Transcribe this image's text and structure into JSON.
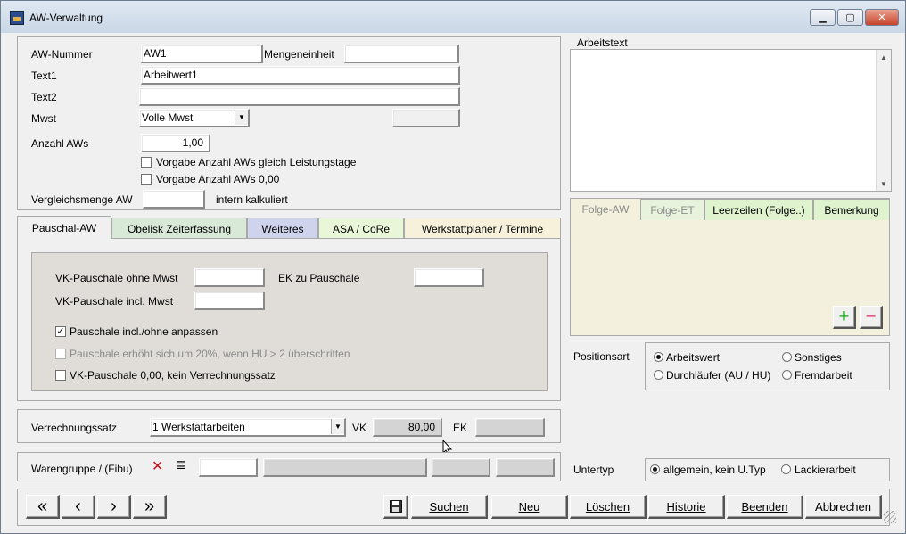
{
  "window": {
    "title": "AW-Verwaltung"
  },
  "fields": {
    "aw_nummer": {
      "label": "AW-Nummer",
      "value": "AW1"
    },
    "mengeneinheit": {
      "label": "Mengeneinheit",
      "value": ""
    },
    "text1": {
      "label": "Text1",
      "value": "Arbeitwert1"
    },
    "text2": {
      "label": "Text2",
      "value": ""
    },
    "mwst": {
      "label": "Mwst",
      "value": "Volle Mwst"
    },
    "anzahl_aws": {
      "label": "Anzahl AWs",
      "value": "1,00"
    },
    "vorgabe_leistungstage": {
      "label": "Vorgabe Anzahl AWs gleich Leistungstage",
      "checked": false
    },
    "vorgabe_null": {
      "label": "Vorgabe Anzahl AWs 0,00",
      "checked": false
    },
    "vergleichsmenge": {
      "label": "Vergleichsmenge AW",
      "value": "",
      "suffix": "intern kalkuliert"
    }
  },
  "tabs": [
    {
      "label": "Pauschal-AW",
      "active": true,
      "color": "#f0f0f0"
    },
    {
      "label": "Obelisk Zeiterfassung",
      "active": false,
      "color": "#d8e9d8"
    },
    {
      "label": "Weiteres",
      "active": false,
      "color": "#cfd3ec"
    },
    {
      "label": "ASA / CoRe",
      "active": false,
      "color": "#eaf6d8"
    },
    {
      "label": "Werkstattplaner / Termine",
      "active": false,
      "color": "#f7f1dc"
    }
  ],
  "pauschal": {
    "vk_ohne_label": "VK-Pauschale ohne Mwst",
    "vk_ohne_value": "",
    "ek_label": "EK zu Pauschale",
    "ek_value": "",
    "vk_incl_label": "VK-Pauschale incl. Mwst",
    "vk_incl_value": "",
    "anpassen": {
      "label": "Pauschale incl./ohne anpassen",
      "checked": true
    },
    "erhoeht": {
      "label": "Pauschale erhöht sich um 20%, wenn HU > 2 überschritten",
      "checked": false
    },
    "kein_satz": {
      "label": "VK-Pauschale 0,00, kein Verrechnungssatz",
      "checked": false
    }
  },
  "verrechnung": {
    "label": "Verrechnungssatz",
    "value": "1 Werkstattarbeiten",
    "vk_label": "VK",
    "vk_value": "80,00",
    "ek_label": "EK",
    "ek_value": ""
  },
  "warengruppe": {
    "label": "Warengruppe / (Fibu)",
    "value": ""
  },
  "arbeitstext": {
    "label": "Arbeitstext",
    "value": ""
  },
  "right_tabs": [
    {
      "label": "Folge-AW",
      "active": true,
      "disabled": true
    },
    {
      "label": "Folge-ET",
      "active": false,
      "disabled": true
    },
    {
      "label": "Leerzeilen (Folge..)",
      "active": false,
      "disabled": false
    },
    {
      "label": "Bemerkung",
      "active": false,
      "disabled": false
    }
  ],
  "positionsart": {
    "label": "Positionsart",
    "options": [
      {
        "label": "Arbeitswert",
        "selected": true
      },
      {
        "label": "Sonstiges",
        "selected": false
      },
      {
        "label": "Durchläufer (AU / HU)",
        "selected": false
      },
      {
        "label": "Fremdarbeit",
        "selected": false
      }
    ]
  },
  "untertyp": {
    "label": "Untertyp",
    "options": [
      {
        "label": "allgemein, kein U.Typ",
        "selected": true
      },
      {
        "label": "Lackierarbeit",
        "selected": false
      }
    ]
  },
  "nav_buttons": {
    "first": "«",
    "prev": "‹",
    "next": "›",
    "last": "»"
  },
  "actions": {
    "suchen": "Suchen",
    "neu": "Neu",
    "loeschen": "Löschen",
    "historie": "Historie",
    "beenden": "Beenden",
    "abbrechen": "Abbrechen"
  },
  "colors": {
    "add": "#1aa11a",
    "remove": "#d6225c",
    "x_red": "#c0141c",
    "right_tab_area": "#f3f1dd"
  }
}
